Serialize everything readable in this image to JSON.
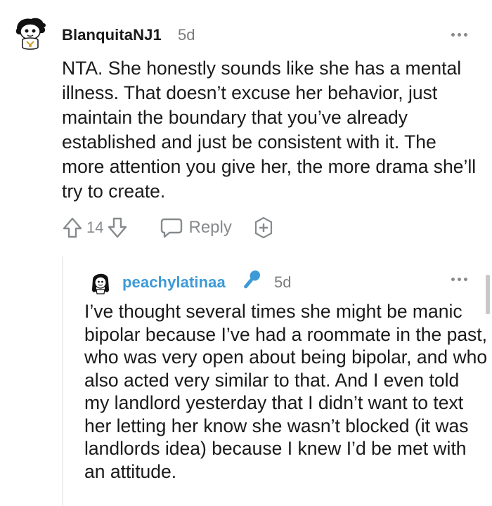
{
  "top_comment": {
    "username": "BlanquitaNJ1",
    "time": "5d",
    "body": "NTA. She honestly sounds like she has a mental illness. That doesn’t excuse her behavior, just maintain the boundary that you’ve already established and just be consistent with it. The more attention you give her, the more drama she’ll try to create.",
    "vote_count": "14",
    "reply_label": "Reply",
    "icons": {
      "more": "more-options-icon",
      "upvote": "upvote-arrow-icon",
      "downvote": "downvote-arrow-icon",
      "reply": "speech-bubble-icon",
      "award": "award-plus-icon"
    }
  },
  "reply_comment": {
    "username": "peachylatinaa",
    "time": "5d",
    "flair_icon": "microphone-icon",
    "body": "I’ve thought several times she might be manic bipolar because I’ve had a roommate in the past, who was very open about being bipolar, and who also acted very similar to that. And I even told my landlord yesterday that I didn’t want to text her letting her know she wasn’t blocked (it was landlords idea) because I knew I’d be met with an attitude."
  },
  "colors": {
    "text": "#1a1a1b",
    "meta": "#7c7c7c",
    "icon": "#878a8c",
    "reply_username": "#3d9ad7",
    "flair": "#3d9ad7"
  }
}
